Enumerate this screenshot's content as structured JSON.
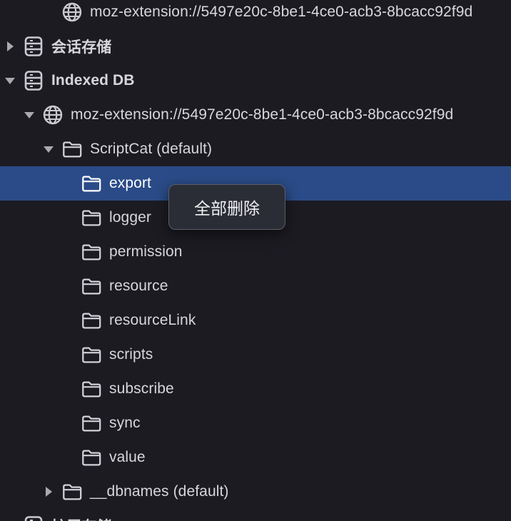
{
  "tree": {
    "rows": [
      {
        "id": "row-ext-origin-top",
        "label": "moz-extension://5497e20c-8be1-4ce0-acb3-8bcacc92f9d",
        "icon": "globe-icon",
        "twisty": "none",
        "depth": 2,
        "bold": false,
        "selected": false
      },
      {
        "id": "row-session-storage",
        "label": "会话存储",
        "icon": "storage-icon",
        "twisty": "right",
        "depth": 0,
        "bold": true,
        "selected": false
      },
      {
        "id": "row-indexed-db",
        "label": "Indexed DB",
        "icon": "storage-icon",
        "twisty": "down",
        "depth": 0,
        "bold": true,
        "selected": false
      },
      {
        "id": "row-ext-origin",
        "label": "moz-extension://5497e20c-8be1-4ce0-acb3-8bcacc92f9d",
        "icon": "globe-icon",
        "twisty": "down",
        "depth": 1,
        "bold": false,
        "selected": false
      },
      {
        "id": "row-scriptcat-db",
        "label": "ScriptCat (default)",
        "icon": "folder-icon",
        "twisty": "down",
        "depth": 2,
        "bold": false,
        "selected": false
      },
      {
        "id": "row-store-export",
        "label": "export",
        "icon": "folder-icon",
        "twisty": "none",
        "depth": 3,
        "bold": false,
        "selected": true
      },
      {
        "id": "row-store-logger",
        "label": "logger",
        "icon": "folder-icon",
        "twisty": "none",
        "depth": 3,
        "bold": false,
        "selected": false
      },
      {
        "id": "row-store-permission",
        "label": "permission",
        "icon": "folder-icon",
        "twisty": "none",
        "depth": 3,
        "bold": false,
        "selected": false
      },
      {
        "id": "row-store-resource",
        "label": "resource",
        "icon": "folder-icon",
        "twisty": "none",
        "depth": 3,
        "bold": false,
        "selected": false
      },
      {
        "id": "row-store-resourcelink",
        "label": "resourceLink",
        "icon": "folder-icon",
        "twisty": "none",
        "depth": 3,
        "bold": false,
        "selected": false
      },
      {
        "id": "row-store-scripts",
        "label": "scripts",
        "icon": "folder-icon",
        "twisty": "none",
        "depth": 3,
        "bold": false,
        "selected": false
      },
      {
        "id": "row-store-subscribe",
        "label": "subscribe",
        "icon": "folder-icon",
        "twisty": "none",
        "depth": 3,
        "bold": false,
        "selected": false
      },
      {
        "id": "row-store-sync",
        "label": "sync",
        "icon": "folder-icon",
        "twisty": "none",
        "depth": 3,
        "bold": false,
        "selected": false
      },
      {
        "id": "row-store-value",
        "label": "value",
        "icon": "folder-icon",
        "twisty": "none",
        "depth": 3,
        "bold": false,
        "selected": false
      },
      {
        "id": "row-dbnames-db",
        "label": "__dbnames (default)",
        "icon": "folder-icon",
        "twisty": "right",
        "depth": 2,
        "bold": false,
        "selected": false
      },
      {
        "id": "row-local-storage",
        "label": "扩展存储",
        "icon": "storage-icon",
        "twisty": "none",
        "depth": 0,
        "bold": true,
        "selected": false
      }
    ]
  },
  "context_menu": {
    "delete_all_label": "全部删除"
  },
  "colors": {
    "background": "#1c1b22",
    "text": "#d7d7db",
    "selection": "#2a4b87",
    "menu_bg": "#2b2d36"
  }
}
